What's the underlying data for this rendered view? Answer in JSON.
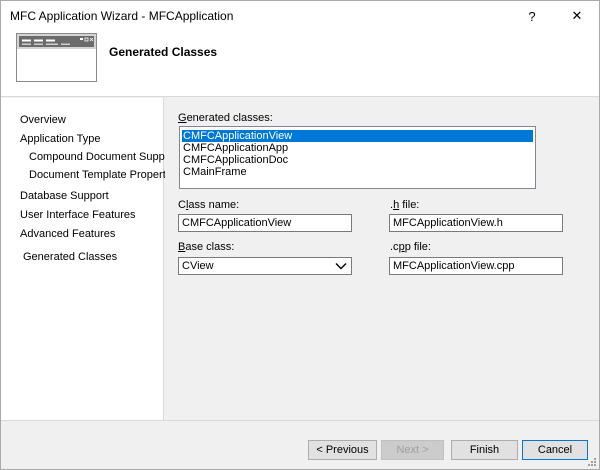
{
  "window": {
    "title": "MFC Application Wizard - MFCApplication",
    "help_glyph": "?",
    "close_glyph": "✕"
  },
  "header": {
    "title": "Generated Classes",
    "icon": "wizard-window-icon"
  },
  "nav": {
    "items": [
      {
        "label": "Overview"
      },
      {
        "label": "Application Type"
      },
      {
        "label": "Compound Document Support"
      },
      {
        "label": "Document Template Properties"
      },
      {
        "label": "Database Support"
      },
      {
        "label": "User Interface Features"
      },
      {
        "label": "Advanced Features"
      },
      {
        "label": "Generated Classes"
      }
    ]
  },
  "form": {
    "generated_classes_label_first": "G",
    "generated_classes_label_rest": "enerated classes:",
    "classes": [
      "CMFCApplicationView",
      "CMFCApplicationApp",
      "CMFCApplicationDoc",
      "CMainFrame"
    ],
    "selected_class": "CMFCApplicationView",
    "class_name_label_pre": "C",
    "class_name_label_u": "l",
    "class_name_label_post": "ass name:",
    "class_name_value": "CMFCApplicationView",
    "h_file_label_pre": ".",
    "h_file_label_u": "h",
    "h_file_label_post": " file:",
    "h_file_value": "MFCApplicationView.h",
    "base_class_label_pre": "",
    "base_class_label_u": "B",
    "base_class_label_post": "ase class:",
    "base_class_value": "CView",
    "cpp_file_label_pre": ".c",
    "cpp_file_label_u": "p",
    "cpp_file_label_post": "p file:",
    "cpp_file_value": "MFCApplicationView.cpp"
  },
  "footer": {
    "previous_label": "< Previous",
    "next_label": "Next >",
    "finish_label": "Finish",
    "cancel_label": "Cancel"
  },
  "colors": {
    "selection": "#0078d7",
    "dialog_bg": "#f0f0f0"
  }
}
